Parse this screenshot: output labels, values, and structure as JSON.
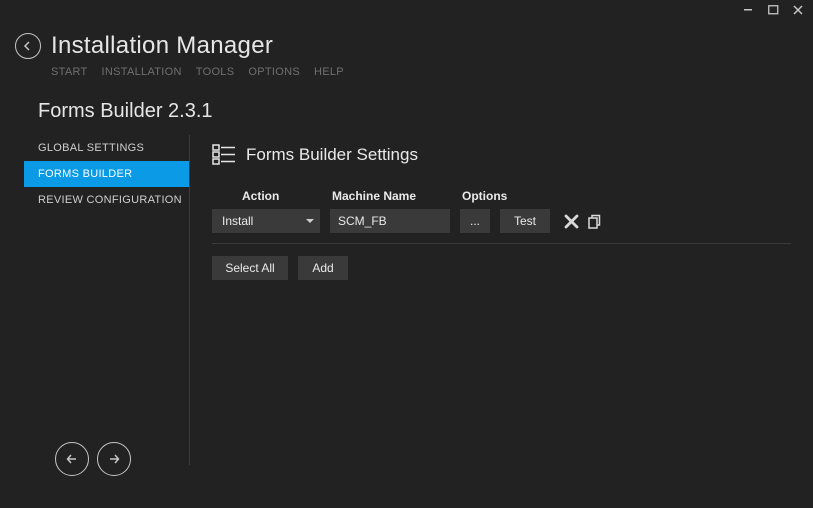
{
  "window": {
    "title": "Installation Manager"
  },
  "menu": {
    "items": [
      "START",
      "INSTALLATION",
      "TOOLS",
      "OPTIONS",
      "HELP"
    ]
  },
  "subtitle": "Forms Builder 2.3.1",
  "sidebar": {
    "items": [
      {
        "label": "GLOBAL SETTINGS",
        "active": false
      },
      {
        "label": "FORMS BUILDER",
        "active": true
      },
      {
        "label": "REVIEW CONFIGURATION",
        "active": false
      }
    ]
  },
  "panel": {
    "title": "Forms Builder Settings",
    "columns": {
      "action": "Action",
      "machine": "Machine Name",
      "options": "Options"
    },
    "row": {
      "action_value": "Install",
      "machine_value": "SCM_FB",
      "ellipsis_label": "...",
      "test_label": "Test"
    },
    "buttons": {
      "select_all": "Select All",
      "add": "Add"
    }
  }
}
